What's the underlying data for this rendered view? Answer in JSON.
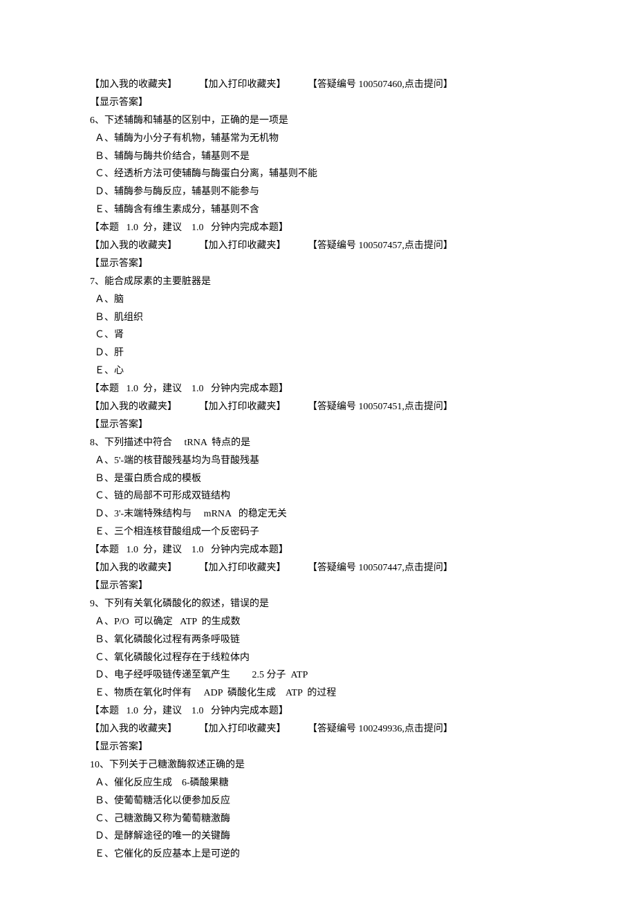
{
  "common": {
    "add_to_my_fav": "【加入我的收藏夹】",
    "add_to_print_fav": "【加入打印收藏夹】",
    "show_answer": "【显示答案】",
    "score_line": "【本题   1.0  分，建议    1.0   分钟内完成本题】"
  },
  "blocks": [
    {
      "faq": "【答疑编号    100507460,点击提问】",
      "stem": "6、下述辅酶和辅基的区别中，正确的是一项是",
      "options": [
        "Ａ、辅酶为小分子有机物，辅基常为无机物",
        "Ｂ、辅酶与酶共价结合，辅基则不是",
        "Ｃ、经透析方法可使辅酶与酶蛋白分离，辅基则不能",
        "Ｄ、辅酶参与酶反应，辅基则不能参与",
        "Ｅ、辅酶含有维生素成分，辅基则不含"
      ],
      "next_faq": "【答疑编号    100507457,点击提问】"
    },
    {
      "stem": "7、能合成尿素的主要脏器是",
      "options": [
        "Ａ、脑",
        "Ｂ、肌组织",
        "Ｃ、肾",
        "Ｄ、肝",
        "Ｅ、心"
      ],
      "next_faq": "【答疑编号    100507451,点击提问】"
    },
    {
      "stem": "8、下列描述中符合     tRNA  特点的是",
      "options": [
        "Ａ、5'-端的核苷酸残基均为鸟苷酸残基",
        "Ｂ、是蛋白质合成的模板",
        "Ｃ、链的局部不可形成双链结构",
        "Ｄ、3'-末端特殊结构与     mRNA   的稳定无关",
        "Ｅ、三个相连核苷酸组成一个反密码子"
      ],
      "next_faq": "【答疑编号    100507447,点击提问】"
    },
    {
      "stem": "9、下列有关氧化磷酸化的叙述，错误的是",
      "options": [
        "Ａ、P/O  可以确定   ATP  的生成数",
        "Ｂ、氧化磷酸化过程有两条呼吸链",
        "Ｃ、氧化磷酸化过程存在于线粒体内",
        "Ｄ、电子经呼吸链传递至氧产生         2.5 分子  ATP",
        "Ｅ、物质在氧化时伴有     ADP  磷酸化生成    ATP  的过程"
      ],
      "next_faq": "【答疑编号    100249936,点击提问】"
    },
    {
      "stem": "10、下列关于己糖激酶叙述正确的是",
      "options": [
        "Ａ、催化反应生成    6-磷酸果糖",
        "Ｂ、使葡萄糖活化以便参加反应",
        "Ｃ、己糖激酶又称为葡萄糖激酶",
        "Ｄ、是酵解途径的唯一的关键酶",
        "Ｅ、它催化的反应基本上是可逆的"
      ]
    }
  ]
}
